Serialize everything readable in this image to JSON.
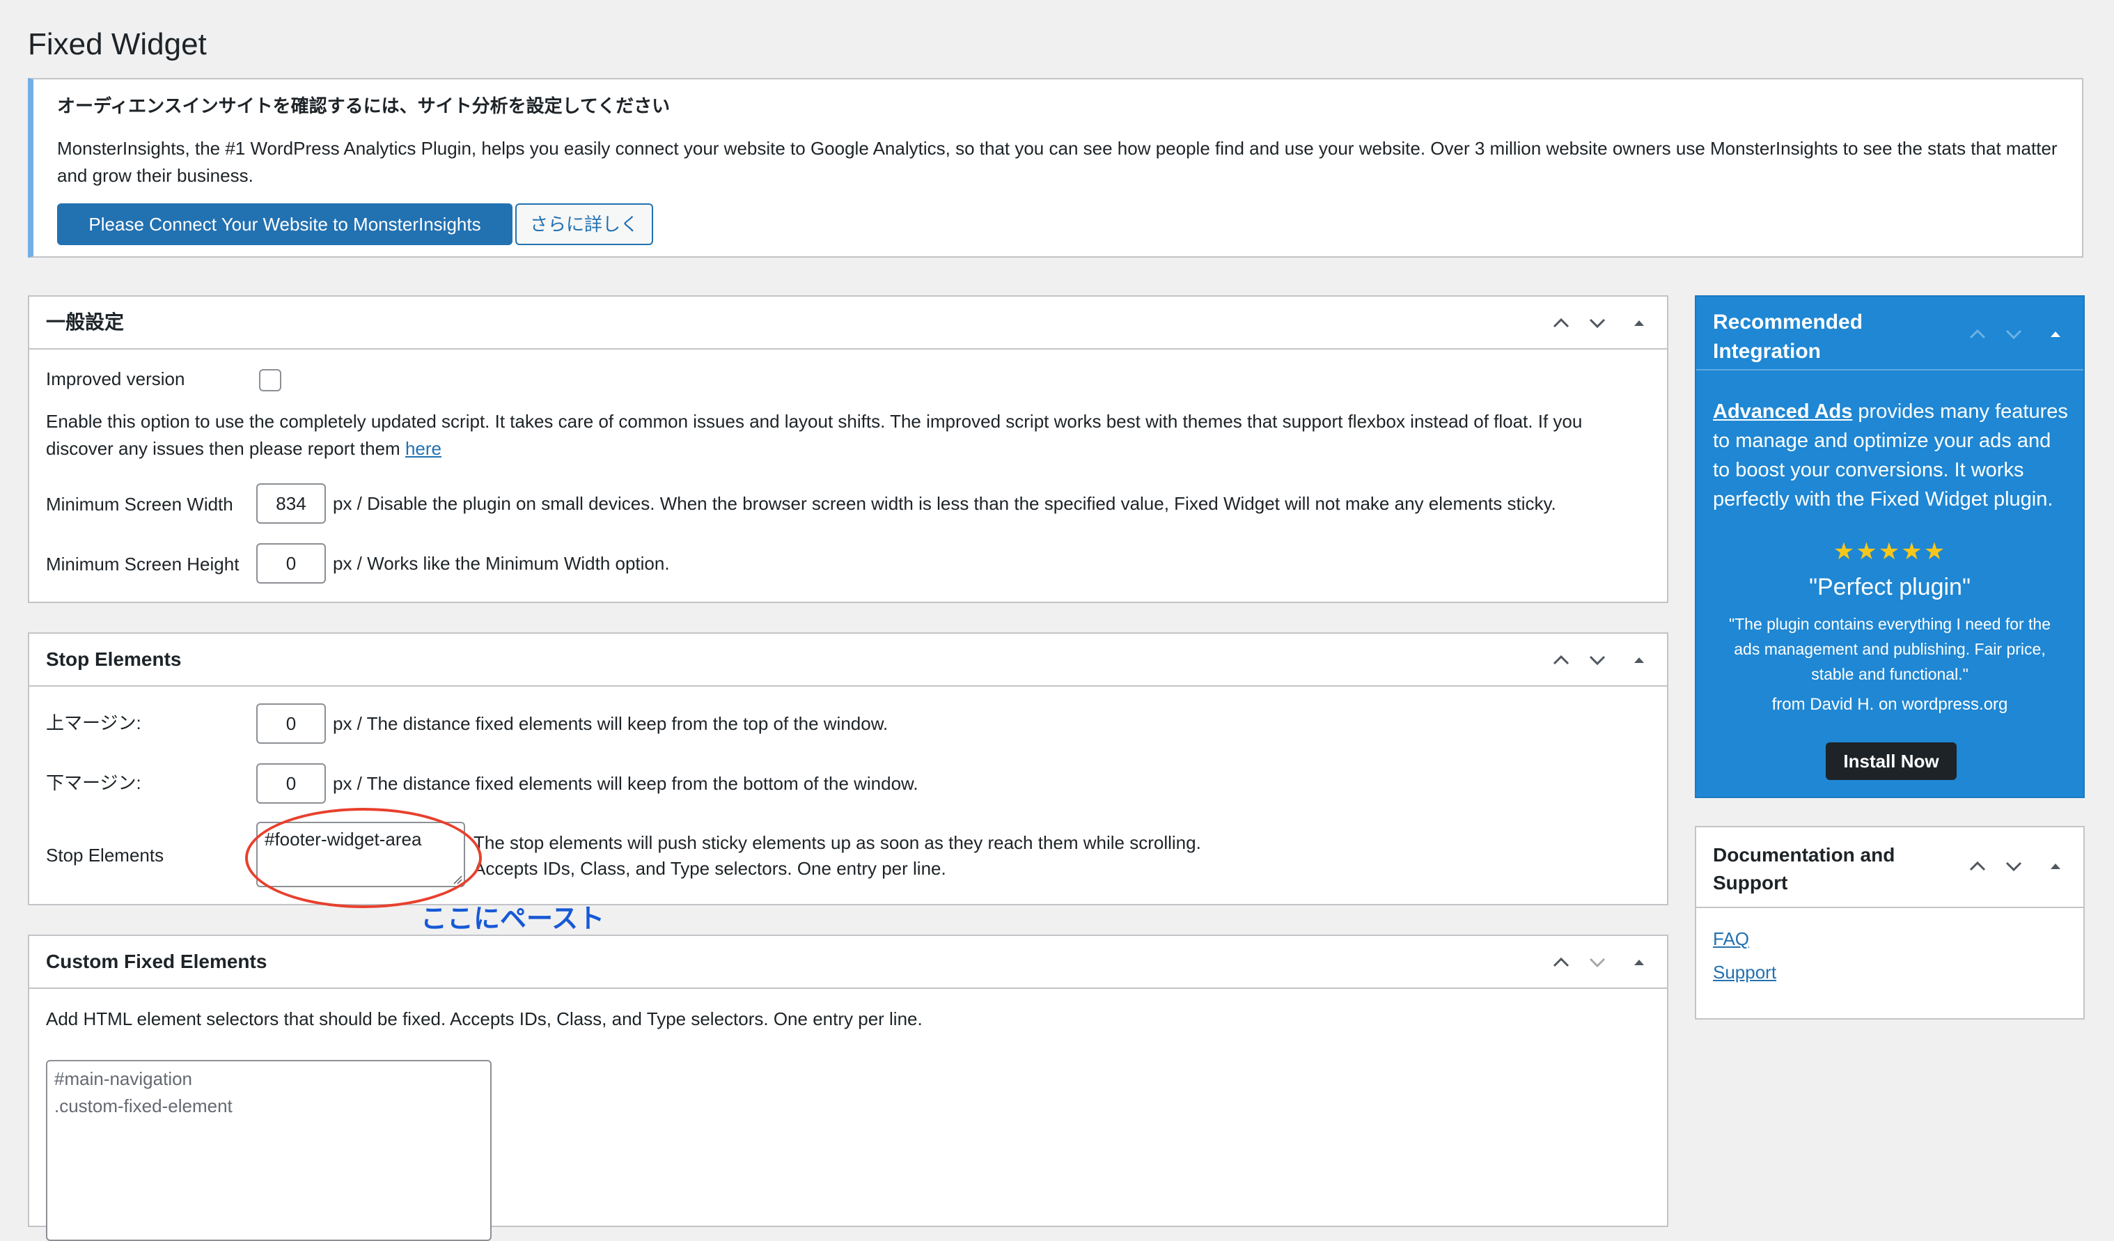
{
  "page_title": "Fixed Widget",
  "notice": {
    "title": "オーディエンスインサイトを確認するには、サイト分析を設定してください",
    "body": "MonsterInsights, the #1 WordPress Analytics Plugin, helps you easily connect your website to Google Analytics, so that you can see how people find and use your website. Over 3 million website owners use MonsterInsights to see the stats that matter and grow their business.",
    "primary_button": "Please Connect Your Website to MonsterInsights",
    "secondary_button": "さらに詳しく",
    "accent_color": "#72aee6"
  },
  "general": {
    "title": "一般設定",
    "improved_label": "Improved version",
    "improved_checked": false,
    "improved_desc": "Enable this option to use the completely updated script. It takes care of common issues and layout shifts. The improved script works best with themes that support flexbox instead of float. If you discover any issues then please report them",
    "improved_link": "here",
    "min_width_label": "Minimum Screen Width",
    "min_width_value": "834",
    "min_width_desc": "px / Disable the plugin on small devices. When the browser screen width is less than the specified value, Fixed Widget will not make any elements sticky.",
    "min_height_label": "Minimum Screen Height",
    "min_height_value": "0",
    "min_height_desc": "px / Works like the Minimum Width option."
  },
  "stop": {
    "title": "Stop Elements",
    "top_margin_label": "上マージン:",
    "top_margin_value": "0",
    "top_margin_desc": "px / The distance fixed elements will keep from the top of the window.",
    "bottom_margin_label": "下マージン:",
    "bottom_margin_value": "0",
    "bottom_margin_desc": "px / The distance fixed elements will keep from the bottom of the window.",
    "stop_label": "Stop Elements",
    "stop_value": "#footer-widget-area",
    "stop_desc_1": "The stop elements will push sticky elements up as soon as they reach them while scrolling.",
    "stop_desc_2": "Accepts IDs, Class, and Type selectors. One entry per line.",
    "annotation": "ここにペースト",
    "annotation_color": "#1659d6",
    "circle_color": "#e8402d"
  },
  "custom": {
    "title": "Custom Fixed Elements",
    "desc": "Add HTML element selectors that should be fixed. Accepts IDs, Class, and Type selectors. One entry per line.",
    "placeholder_line1": "#main-navigation",
    "placeholder_line2": ".custom-fixed-element"
  },
  "recommended": {
    "title": "Recommended Integration",
    "link_text": "Advanced Ads",
    "body": " provides many features to manage and optimize your ads and to boost your conversions. It works perfectly with the Fixed Widget plugin.",
    "stars": "★★★★★",
    "rating": 5,
    "quote_title": "\"Perfect plugin\"",
    "quote_body": "\"The plugin contains everything I need for the ads management and publishing. Fair price, stable and functional.\"",
    "quote_from": "from David H. on wordpress.org",
    "install_button": "Install Now",
    "bg_color": "#1f87d3"
  },
  "docs": {
    "title": "Documentation and Support",
    "links": [
      "FAQ",
      "Support"
    ]
  }
}
